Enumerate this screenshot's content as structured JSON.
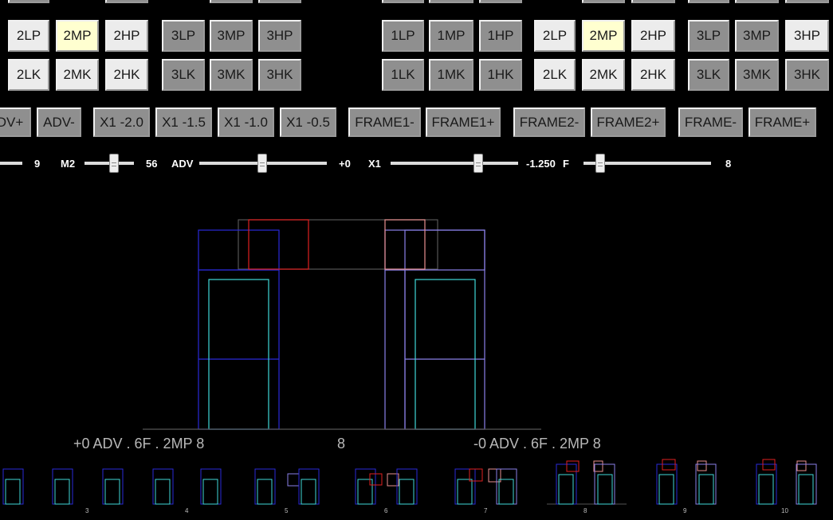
{
  "button_grid": {
    "group1": {
      "row1": [
        "2LP",
        "2MP",
        "2HP"
      ],
      "row2": [
        "2LK",
        "2MK",
        "2HK"
      ]
    },
    "group2": {
      "row1": [
        "3LP",
        "3MP",
        "3HP"
      ],
      "row2": [
        "3LK",
        "3MK",
        "3HK"
      ]
    },
    "group3": {
      "row1": [
        "1LP",
        "1MP",
        "1HP"
      ],
      "row2": [
        "1LK",
        "1MK",
        "1HK"
      ]
    },
    "group4": {
      "row1": [
        "2LP",
        "2MP",
        "2HP"
      ],
      "row2": [
        "2LK",
        "2MK",
        "2HK"
      ]
    },
    "group5": {
      "row1": [
        "3LP",
        "3MP",
        "3HP"
      ],
      "row2": [
        "3LK",
        "3MK",
        "3HK"
      ]
    },
    "selected": [
      "2MP"
    ]
  },
  "control_row": {
    "adv_plus": "DV+",
    "adv_minus": "ADV-",
    "x1_m20": "X1 -2.0",
    "x1_m15": "X1 -1.5",
    "x1_m10": "X1 -1.0",
    "x1_m05": "X1 -0.5",
    "frame1_minus": "FRAME1-",
    "frame1_plus": "FRAME1+",
    "frame2_minus": "FRAME2-",
    "frame2_plus": "FRAME2+",
    "frame_minus": "FRAME-",
    "frame_plus": "FRAME+"
  },
  "sliders": {
    "first_value": "9",
    "m2_label": "M2",
    "m2_value": "56",
    "adv_label": "ADV",
    "adv_value": "+0",
    "x1_label": "X1",
    "x1_value": "-1.250",
    "f_label": "F",
    "f_value": "8"
  },
  "captions": {
    "left": "+0 ADV . 6F . 2MP 8",
    "center": "8",
    "right": "-0 ADV . 6F . 2MP 8"
  },
  "timeline": {
    "frame_numbers": [
      "3",
      "4",
      "5",
      "6",
      "7",
      "8",
      "9",
      "10"
    ]
  },
  "colors": {
    "background": "#000000",
    "hurtbox": "#2a2ad8",
    "hurtbox_light": "#8a80e8",
    "pushbox": "#40d8d8",
    "hitbox": "#e02020",
    "hitbox_light": "#e89090",
    "throwbox": "#555555",
    "selected_button": "#ffffd0",
    "active_button": "#ececec",
    "inactive_button": "#8f8f8f"
  }
}
